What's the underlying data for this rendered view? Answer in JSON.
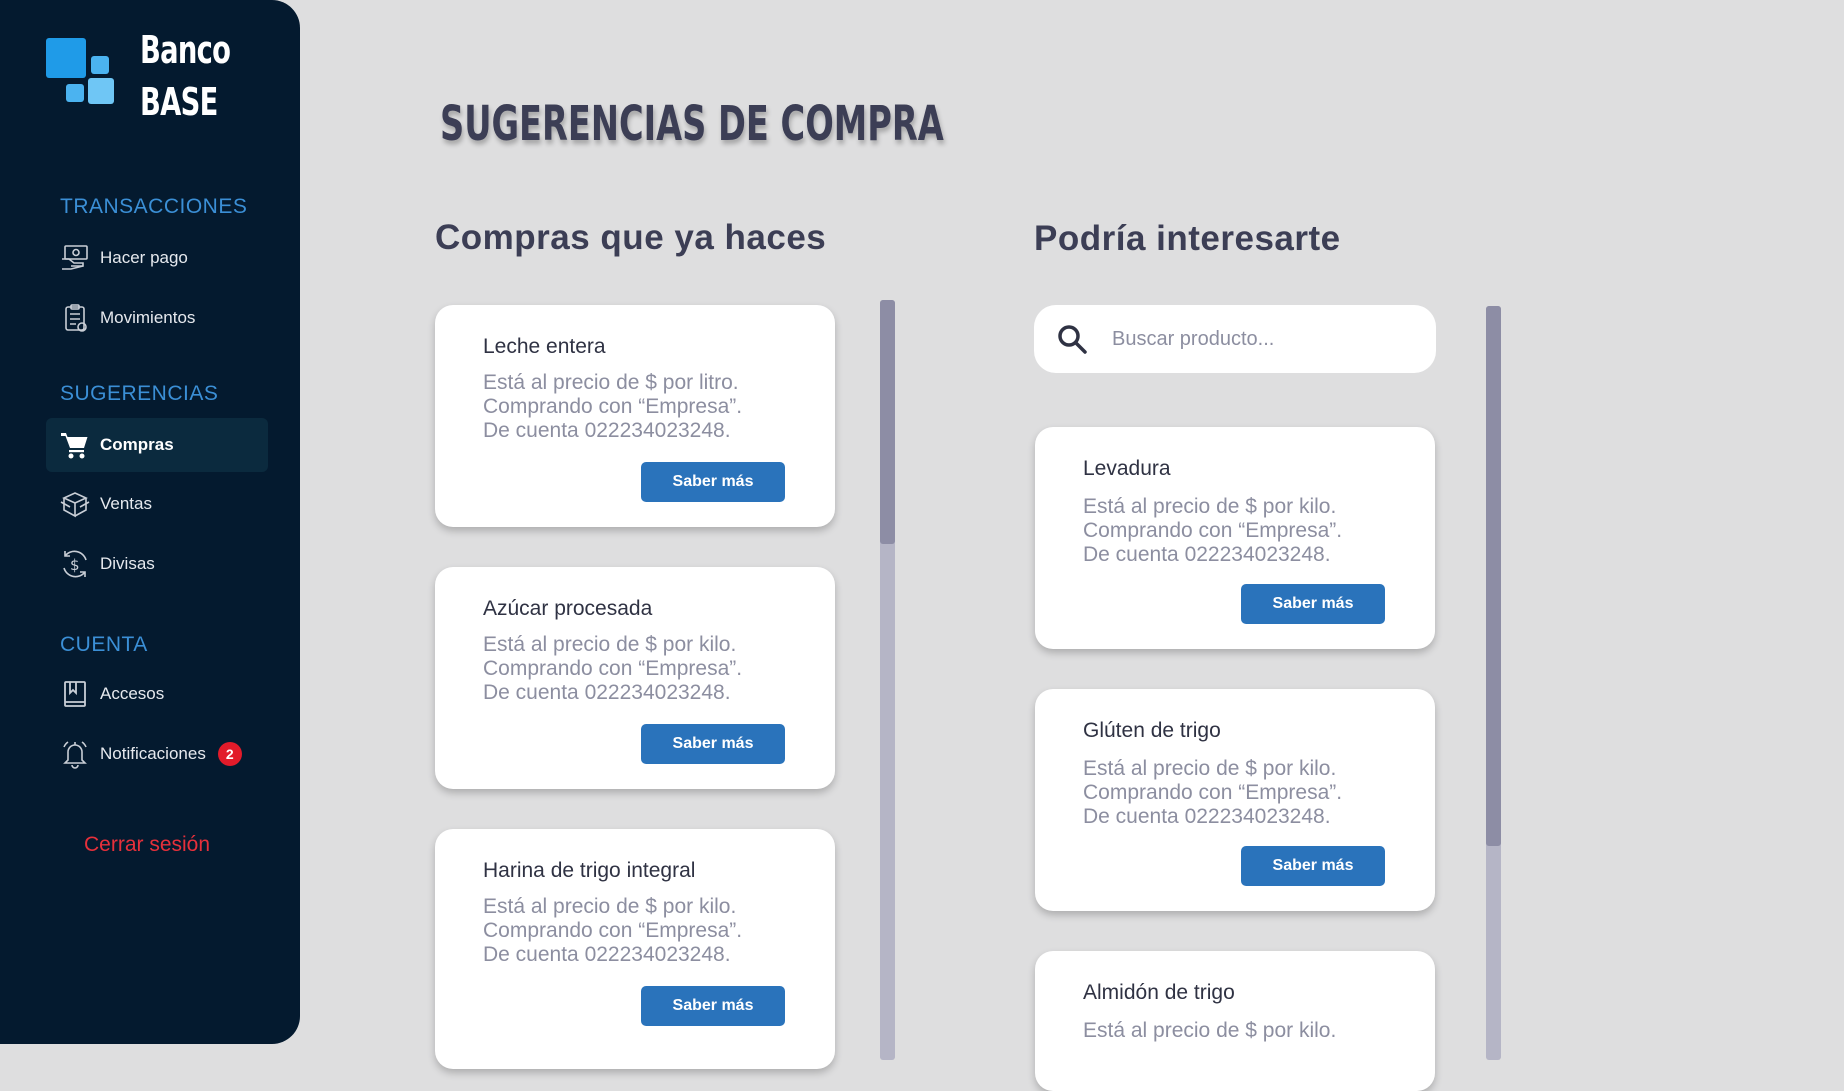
{
  "brand": {
    "line1": "Banco",
    "line2": "BASE"
  },
  "sidebar": {
    "sections": [
      {
        "title": "TRANSACCIONES"
      },
      {
        "title": "SUGERENCIAS"
      },
      {
        "title": "CUENTA"
      }
    ],
    "items": [
      {
        "label": "Hacer pago",
        "icon": "payment-icon"
      },
      {
        "label": "Movimientos",
        "icon": "receipt-icon"
      },
      {
        "label": "Compras",
        "icon": "cart-icon",
        "active": true
      },
      {
        "label": "Ventas",
        "icon": "box-icon"
      },
      {
        "label": "Divisas",
        "icon": "currency-exchange-icon"
      },
      {
        "label": "Accesos",
        "icon": "book-icon"
      },
      {
        "label": "Notificaciones",
        "icon": "bell-icon",
        "badge": "2"
      }
    ],
    "logout": "Cerrar sesión"
  },
  "main": {
    "title": "SUGERENCIAS DE COMPRA",
    "left_column": {
      "title": "Compras que ya haces",
      "cards": [
        {
          "name": "Leche entera",
          "description": "Está al precio de $ por litro.\nComprando con “Empresa”.\nDe cuenta 022234023248.",
          "button": "Saber más"
        },
        {
          "name": "Azúcar procesada",
          "description": "Está al precio de $ por kilo.\nComprando con “Empresa”.\nDe cuenta 022234023248.",
          "button": "Saber más"
        },
        {
          "name": "Harina de trigo integral",
          "description": "Está al precio de $ por kilo.\nComprando con “Empresa”.\nDe cuenta 022234023248.",
          "button": "Saber más"
        }
      ]
    },
    "right_column": {
      "title": "Podría interesarte",
      "search": {
        "placeholder": "Buscar producto..."
      },
      "cards": [
        {
          "name": "Levadura",
          "description": "Está al precio de $ por kilo.\nComprando con “Empresa”.\nDe cuenta 022234023248.",
          "button": "Saber más"
        },
        {
          "name": "Glúten de trigo",
          "description": "Está al precio de $ por kilo.\nComprando con “Empresa”.\nDe cuenta 022234023248.",
          "button": "Saber más"
        },
        {
          "name": "Almidón de trigo",
          "description": "Está al precio de $ por kilo.",
          "button": ""
        }
      ]
    }
  },
  "colors": {
    "sidebar_bg": "#041a2f",
    "accent": "#2a73bb",
    "section": "#3b8fd6",
    "logout": "#e6303b",
    "badge": "#e21b2a"
  }
}
